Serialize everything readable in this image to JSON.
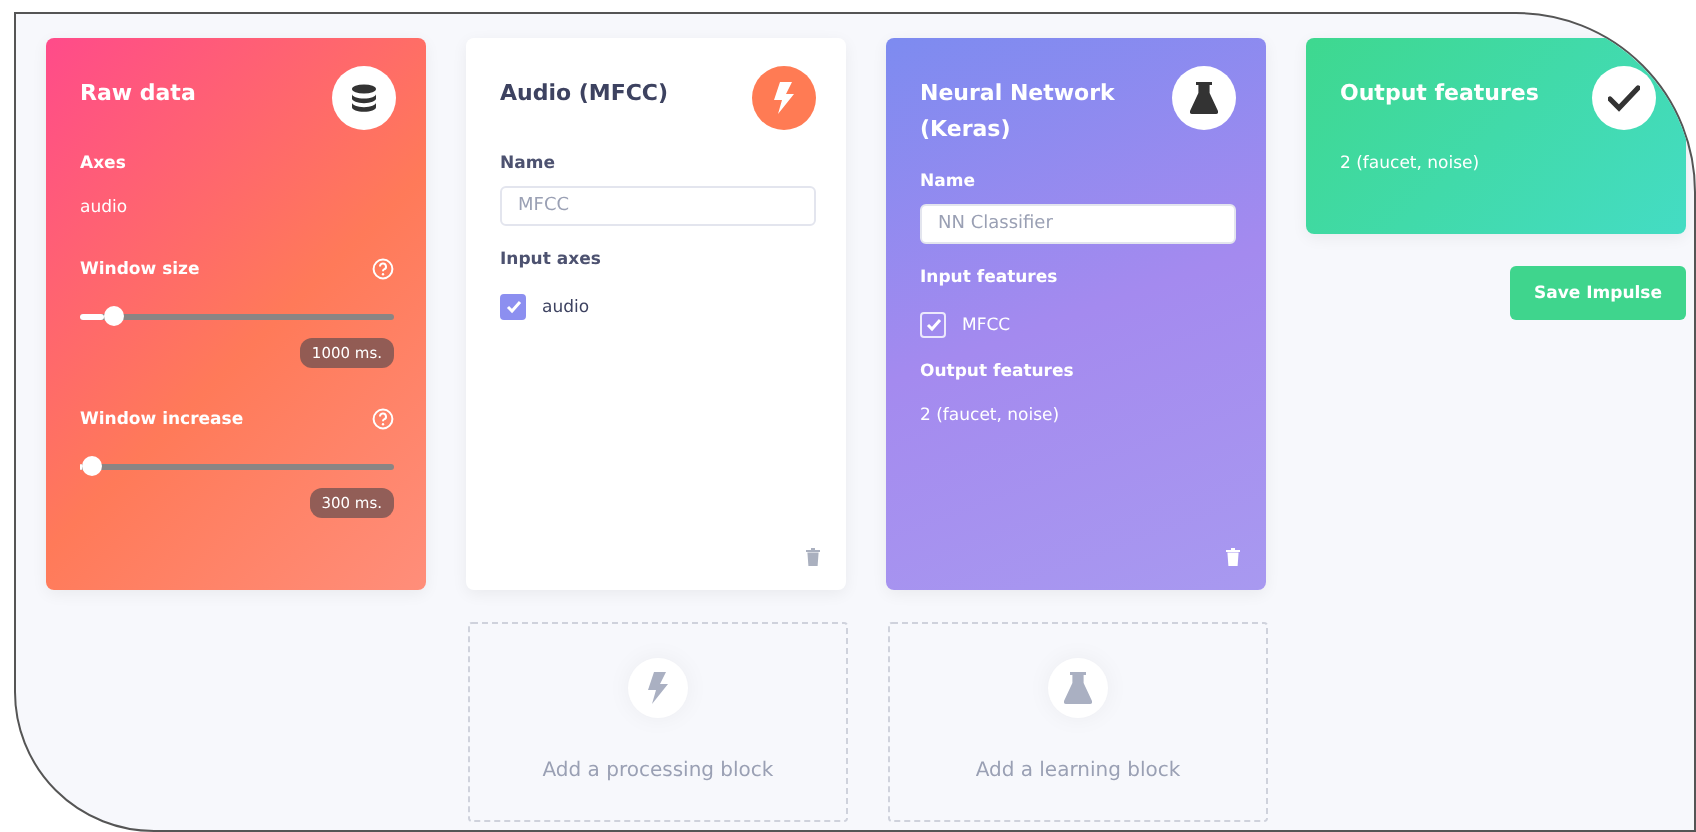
{
  "blocks": [
    {
      "kind": "input",
      "title": "Raw data",
      "deletable": false,
      "items": [
        {
          "kind": "label",
          "text": "Axes"
        },
        {
          "kind": "value",
          "text": "audio"
        },
        {
          "kind": "slider",
          "label": "Window size",
          "level": 0.11,
          "reading": "1000 ms."
        },
        {
          "kind": "slider",
          "label": "Window increase",
          "level": 0.04,
          "reading": "300 ms."
        }
      ]
    },
    {
      "kind": "processing",
      "title": "Audio (MFCC)",
      "deletable": true,
      "items": [
        {
          "kind": "label",
          "text": "Name"
        },
        {
          "kind": "field",
          "value": "MFCC"
        },
        {
          "kind": "label",
          "text": "Input axes"
        },
        {
          "kind": "checkbox",
          "label": "audio",
          "checked": true
        }
      ]
    },
    {
      "kind": "learning",
      "title": "Neural Network (Keras)",
      "deletable": true,
      "items": [
        {
          "kind": "label",
          "text": "Name"
        },
        {
          "kind": "field",
          "value": "NN Classifier"
        },
        {
          "kind": "label",
          "text": "Input features"
        },
        {
          "kind": "checkbox",
          "label": "MFCC",
          "checked": true
        },
        {
          "kind": "label",
          "text": "Output features"
        },
        {
          "kind": "value",
          "text": "2 (faucet, noise)"
        }
      ]
    },
    {
      "kind": "output",
      "title": "Output features",
      "deletable": false,
      "items": [
        {
          "kind": "value",
          "text": "2 (faucet, noise)"
        }
      ]
    }
  ],
  "save_button": "Save Impulse",
  "add_blocks": [
    {
      "kind": "processing",
      "label": "Add a processing block"
    },
    {
      "kind": "learning",
      "label": "Add a learning block"
    }
  ]
}
